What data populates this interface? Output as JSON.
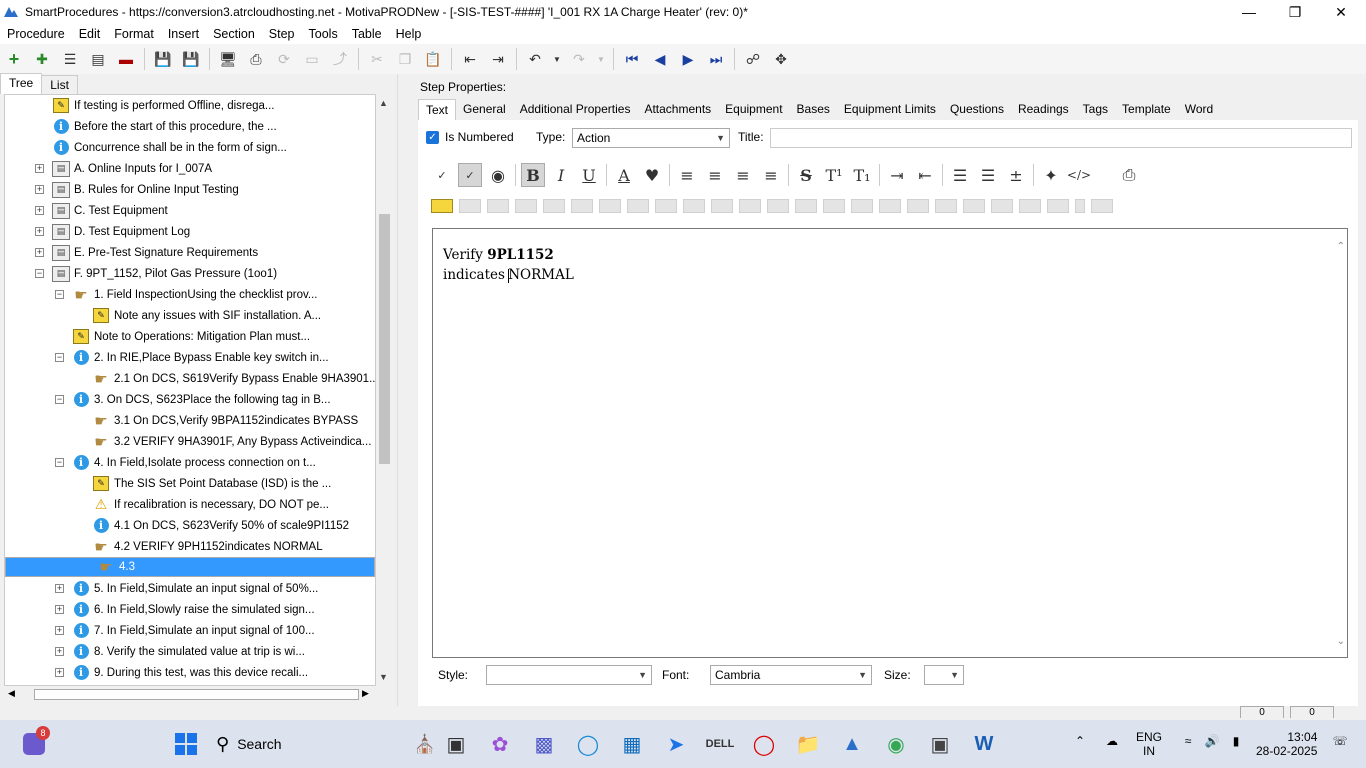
{
  "window": {
    "title": "SmartProcedures - https://conversion3.atrcloudhosting.net - MotivaPRODNew - [-SIS-TEST-####] 'I_001 RX 1A Charge Heater' (rev: 0)*"
  },
  "menu": [
    "Procedure",
    "Edit",
    "Format",
    "Insert",
    "Section",
    "Step",
    "Tools",
    "Table",
    "Help"
  ],
  "left_tabs": [
    "Tree",
    "List"
  ],
  "tree": [
    {
      "indent": 0,
      "icon": "note-icon",
      "exp": "",
      "text": "If testing is performed Offline, disrega..."
    },
    {
      "indent": 0,
      "icon": "info-icon",
      "exp": "",
      "text": "Before the start of this procedure, the ..."
    },
    {
      "indent": 0,
      "icon": "info-icon",
      "exp": "",
      "text": "Concurrence shall be in the form of sign..."
    },
    {
      "indent": 0,
      "icon": "section-icon",
      "exp": "+",
      "text": "A. Online Inputs for I_007A"
    },
    {
      "indent": 0,
      "icon": "section-icon",
      "exp": "+",
      "text": "B. Rules for Online Input Testing"
    },
    {
      "indent": 0,
      "icon": "section-icon",
      "exp": "+",
      "text": "C. Test Equipment"
    },
    {
      "indent": 0,
      "icon": "section-icon",
      "exp": "+",
      "text": "D. Test Equipment Log"
    },
    {
      "indent": 0,
      "icon": "section-icon",
      "exp": "+",
      "text": "E. Pre-Test Signature Requirements"
    },
    {
      "indent": 0,
      "icon": "section-icon",
      "exp": "-",
      "text": "F. 9PT_1152, Pilot Gas Pressure (1oo1)"
    },
    {
      "indent": 1,
      "icon": "hand-icon",
      "exp": "-",
      "text": "1. Field InspectionUsing the checklist prov..."
    },
    {
      "indent": 2,
      "icon": "note-icon",
      "exp": "",
      "text": "Note any issues with SIF installation. A..."
    },
    {
      "indent": 1,
      "icon": "note-icon",
      "exp": "",
      "text": "Note to Operations: Mitigation Plan must..."
    },
    {
      "indent": 1,
      "icon": "info-icon",
      "exp": "-",
      "text": "2. In RIE,Place Bypass Enable key switch in..."
    },
    {
      "indent": 2,
      "icon": "hand-icon",
      "exp": "",
      "text": "2.1 On DCS, S619Verify Bypass Enable 9HA3901..."
    },
    {
      "indent": 1,
      "icon": "info-icon",
      "exp": "-",
      "text": "3. On DCS, S623Place the following tag in B..."
    },
    {
      "indent": 2,
      "icon": "hand-icon",
      "exp": "",
      "text": "3.1 On DCS,Verify 9BPA1152indicates BYPASS"
    },
    {
      "indent": 2,
      "icon": "hand-icon",
      "exp": "",
      "text": "3.2 VERIFY 9HA3901F, Any Bypass Activeindica..."
    },
    {
      "indent": 1,
      "icon": "info-icon",
      "exp": "-",
      "text": "4. In Field,Isolate process connection on t..."
    },
    {
      "indent": 2,
      "icon": "note-icon",
      "exp": "",
      "text": "The SIS Set Point Database (ISD) is the ..."
    },
    {
      "indent": 2,
      "icon": "warning-icon",
      "exp": "",
      "text": "If recalibration is necessary, DO NOT pe..."
    },
    {
      "indent": 2,
      "icon": "info-icon",
      "exp": "",
      "text": "4.1 On DCS, S623Verify 50% of scale9PI1152"
    },
    {
      "indent": 2,
      "icon": "hand-icon",
      "exp": "",
      "text": "4.2 VERIFY 9PH1152indicates NORMAL"
    },
    {
      "indent": 2,
      "icon": "hand-icon",
      "exp": "",
      "text": "4.3",
      "selected": true
    },
    {
      "indent": 1,
      "icon": "info-icon",
      "exp": "+",
      "text": "5. In Field,Simulate an input signal of 50%..."
    },
    {
      "indent": 1,
      "icon": "info-icon",
      "exp": "+",
      "text": "6. In Field,Slowly raise the simulated sign..."
    },
    {
      "indent": 1,
      "icon": "info-icon",
      "exp": "+",
      "text": "7. In Field,Simulate an input signal of 100..."
    },
    {
      "indent": 1,
      "icon": "info-icon",
      "exp": "+",
      "text": "8. Verify the simulated value at trip is wi..."
    },
    {
      "indent": 1,
      "icon": "info-icon",
      "exp": "+",
      "text": "9. During this test, was this device recali..."
    }
  ],
  "step_properties": {
    "header": "Step Properties:",
    "tabs": [
      "Text",
      "General",
      "Additional Properties",
      "Attachments",
      "Equipment",
      "Bases",
      "Equipment Limits",
      "Questions",
      "Readings",
      "Tags",
      "Template",
      "Word"
    ],
    "is_numbered_label": "Is Numbered",
    "type_label": "Type:",
    "type_value": "Action",
    "title_label": "Title:",
    "title_value": "",
    "editor": {
      "line1_plain": "Verify ",
      "line1_bold": "9PL1152",
      "line2_before": "indicates ",
      "line2_after": "NORMAL"
    },
    "style_label": "Style:",
    "style_value": "",
    "font_label": "Font:",
    "font_value": "Cambria",
    "size_label": "Size:",
    "size_value": ""
  },
  "taskbar": {
    "search_label": "Search",
    "notification_badge": "8",
    "lang_line1": "ENG",
    "lang_line2": "IN",
    "time": "13:04",
    "date": "28-02-2025"
  },
  "status": {
    "field1": "0",
    "field2": "0"
  }
}
